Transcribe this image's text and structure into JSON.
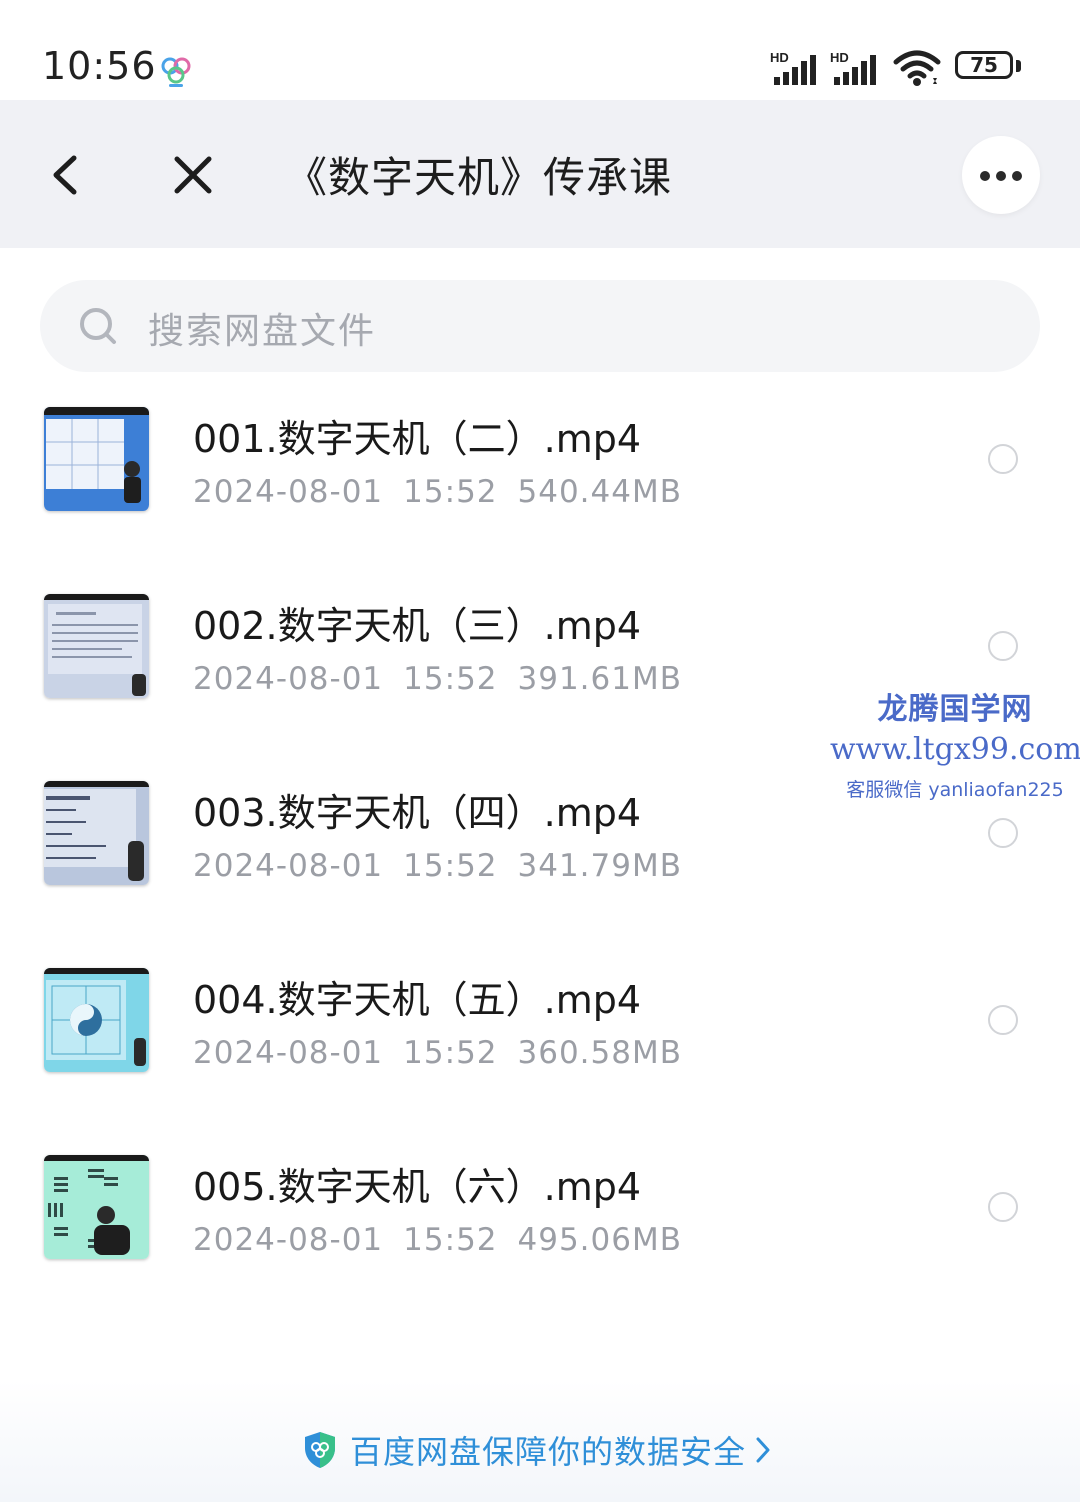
{
  "status_bar": {
    "time": "10:56",
    "app_icon": "baidu-netdisk-icon",
    "signal_1_label": "HD",
    "signal_2_label": "HD",
    "wifi_icon": "wifi-icon",
    "battery_level": "75"
  },
  "nav": {
    "back_icon": "chevron-left-icon",
    "close_icon": "close-icon",
    "title": "《数字天机》传承课",
    "more_icon": "more-horizontal-icon"
  },
  "search": {
    "placeholder": "搜索网盘文件",
    "icon": "search-icon"
  },
  "files": [
    {
      "name": "001.数字天机（二）.mp4",
      "date": "2024-08-01",
      "time": "15:52",
      "size": "540.44MB"
    },
    {
      "name": "002.数字天机（三）.mp4",
      "date": "2024-08-01",
      "time": "15:52",
      "size": "391.61MB"
    },
    {
      "name": "003.数字天机（四）.mp4",
      "date": "2024-08-01",
      "time": "15:52",
      "size": "341.79MB"
    },
    {
      "name": "004.数字天机（五）.mp4",
      "date": "2024-08-01",
      "time": "15:52",
      "size": "360.58MB"
    },
    {
      "name": "005.数字天机（六）.mp4",
      "date": "2024-08-01",
      "time": "15:52",
      "size": "495.06MB"
    }
  ],
  "watermark": {
    "title": "龙腾国学网",
    "url": "www.ltgx99.com",
    "contact": "客服微信 yanliaofan225"
  },
  "footer": {
    "text": "百度网盘保障你的数据安全",
    "shield_icon": "shield-icon",
    "chevron_icon": "chevron-right-icon",
    "color": "#2f8fd8"
  }
}
